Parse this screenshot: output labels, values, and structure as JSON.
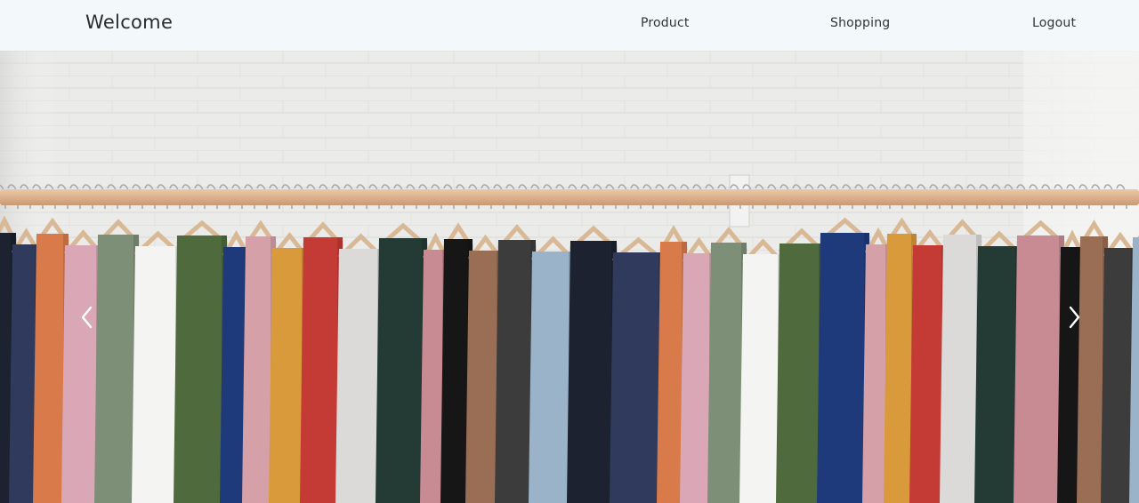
{
  "navbar": {
    "brand": "Welcome",
    "links": [
      {
        "label": "Product"
      },
      {
        "label": "Shopping"
      },
      {
        "label": "Logout"
      }
    ]
  },
  "carousel": {
    "slide_subject": "clothes-rack-photo",
    "prev_icon": "chevron-left-icon",
    "next_icon": "chevron-right-icon"
  },
  "colors": {
    "navbar_bg": "#f3f8fb",
    "wall": "#e9e9e7",
    "rod": "#d9b08c",
    "garments": [
      "#1c2230",
      "#2f3a5c",
      "#d87a4a",
      "#d9a7b5",
      "#7d8f76",
      "#f4f4f2",
      "#4f6a3c",
      "#1f3a7a",
      "#d6a0a8",
      "#d89a3a",
      "#c43a35",
      "#dcdad8",
      "#233a35",
      "#c98b93",
      "#161616",
      "#9a6e55",
      "#3c3c3c",
      "#9bb3c9"
    ]
  }
}
